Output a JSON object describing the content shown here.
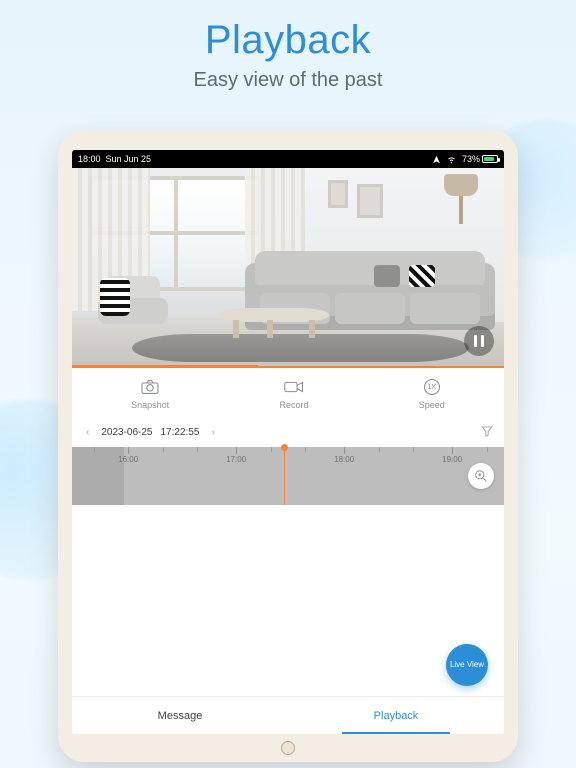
{
  "hero": {
    "title": "Playback",
    "subtitle": "Easy view of the past"
  },
  "statusbar": {
    "time": "18:00",
    "date": "Sun Jun 25",
    "battery": "73%"
  },
  "actions": {
    "snapshot": "Snapshot",
    "record": "Record",
    "speed": "Speed",
    "speed_value": "1X"
  },
  "date_selector": {
    "date": "2023-06-25",
    "time": "17:22:55"
  },
  "timeline": {
    "ticks": [
      "16:00",
      "17:00",
      "18:00",
      "19:00"
    ]
  },
  "fab": {
    "label": "Live View"
  },
  "tabs": {
    "message": "Message",
    "playback": "Playback"
  }
}
